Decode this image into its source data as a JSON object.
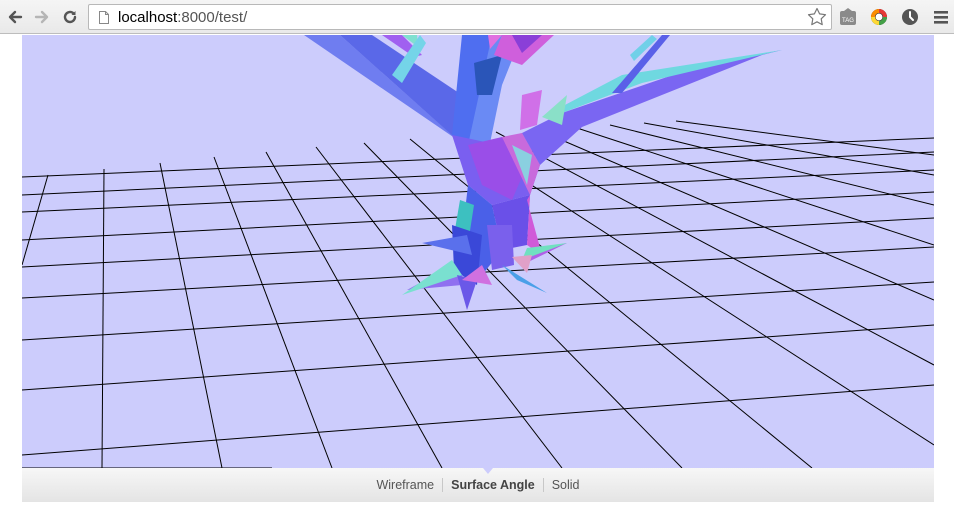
{
  "browser": {
    "url_host": "localhost",
    "url_path": ":8000/test/",
    "icons": [
      "back-arrow-icon",
      "forward-arrow-icon",
      "reload-icon",
      "page-icon",
      "star-icon",
      "tag-extension-icon",
      "color-wheel-extension-icon",
      "clock-extension-icon",
      "menu-icon"
    ]
  },
  "scene": {
    "background": "#ccccfc",
    "grid_color": "#000000"
  },
  "modes": {
    "wireframe": "Wireframe",
    "surface_angle": "Surface Angle",
    "solid": "Solid",
    "active": "Surface Angle"
  }
}
